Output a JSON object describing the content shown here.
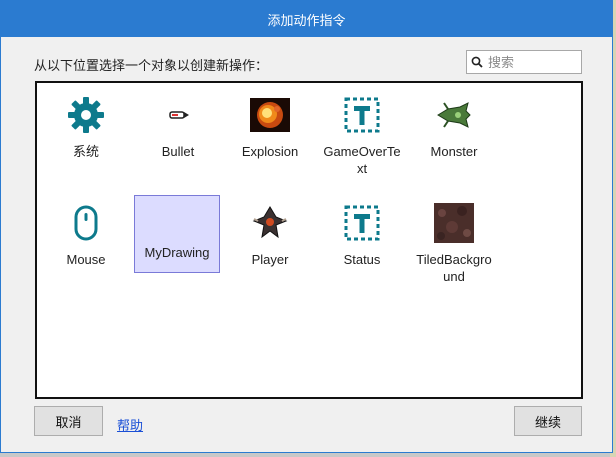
{
  "dialog": {
    "title": "添加动作指令",
    "prompt": "从以下位置选择一个对象以创建新操作：",
    "search_placeholder": "搜索",
    "cancel_label": "取消",
    "help_label": "帮助",
    "continue_label": "继续"
  },
  "objects": [
    {
      "label": "系统",
      "icon": "gear-icon"
    },
    {
      "label": "Bullet",
      "icon": "bullet-sprite"
    },
    {
      "label": "Explosion",
      "icon": "explosion-sprite"
    },
    {
      "label": "GameOverText",
      "icon": "text-object-icon"
    },
    {
      "label": "Monster",
      "icon": "monster-sprite"
    },
    {
      "label": "Mouse",
      "icon": "mouse-icon"
    },
    {
      "label": "MyDrawing",
      "icon": "drawing-object",
      "selected": true
    },
    {
      "label": "Player",
      "icon": "player-sprite"
    },
    {
      "label": "Status",
      "icon": "text-object-icon"
    },
    {
      "label": "TiledBackground",
      "icon": "tiled-background-sprite"
    }
  ],
  "colors": {
    "titlebar": "#2b7bd0",
    "accent_icon": "#0d7a8c",
    "selected_bg": "#dcdcff"
  }
}
